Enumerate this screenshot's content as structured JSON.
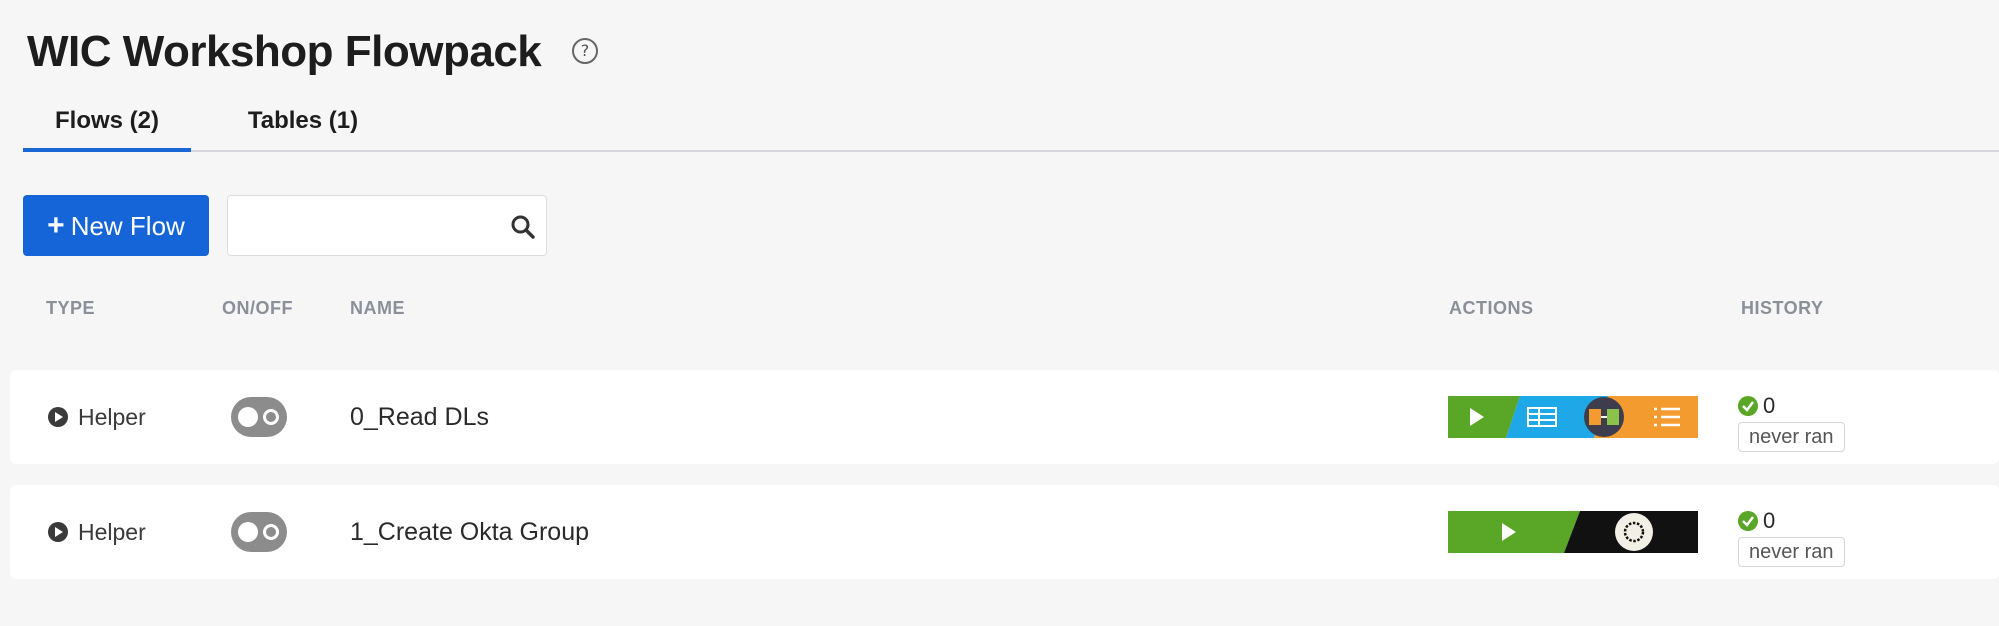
{
  "header": {
    "title": "WIC Workshop Flowpack",
    "help_icon": "?"
  },
  "tabs": [
    {
      "label": "Flows (2)",
      "active": true
    },
    {
      "label": "Tables (1)",
      "active": false
    }
  ],
  "toolbar": {
    "new_flow_plus": "+",
    "new_flow_label": "New Flow",
    "search_value": "",
    "search_placeholder": ""
  },
  "table": {
    "columns": [
      "TYPE",
      "ON/OFF",
      "NAME",
      "ACTIONS",
      "HISTORY"
    ],
    "rows": [
      {
        "type": "Helper",
        "enabled": false,
        "name": "0_Read DLs",
        "actions": [
          "play-icon",
          "table-icon",
          "transform-icon",
          "list-icon"
        ],
        "history_count": "0",
        "history_status": "never ran"
      },
      {
        "type": "Helper",
        "enabled": false,
        "name": "1_Create Okta Group",
        "actions": [
          "play-icon",
          "okta-icon"
        ],
        "history_count": "0",
        "history_status": "never ran"
      }
    ]
  },
  "colors": {
    "accent": "#1565d8",
    "action_green": "#5aa626",
    "action_blue": "#1fa8e8",
    "action_orange": "#f49b30",
    "action_dark": "#111111",
    "success": "#5aa626"
  }
}
